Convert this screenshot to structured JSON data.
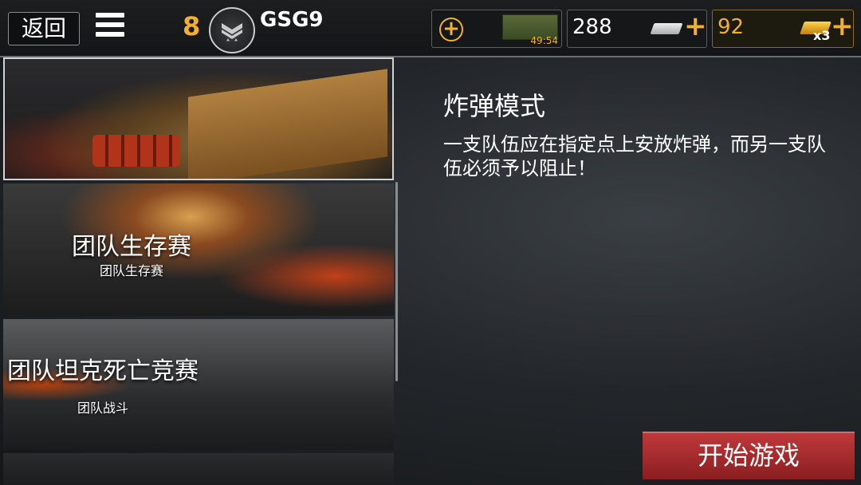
{
  "header": {
    "back_label": "返回",
    "level": "8",
    "player_name": "GSG9",
    "crate_timer": "49:54",
    "silver": "288",
    "gold": "92",
    "gold_multiplier": "x3"
  },
  "modes": [
    {
      "title": "",
      "subtitle": "",
      "selected": true,
      "icon": "dynamite-crate-image"
    },
    {
      "title": "团队生存赛",
      "subtitle": "团队生存赛",
      "selected": false
    },
    {
      "title": "团队坦克死亡竞赛",
      "subtitle": "团队战斗",
      "selected": false
    },
    {
      "title": "",
      "subtitle": "",
      "selected": false
    }
  ],
  "detail": {
    "title": "炸弹模式",
    "description": "一支队伍应在指定点上安放炸弹，而另一支队伍必须予以阻止！"
  },
  "start_label": "开始游戏",
  "colors": {
    "accent": "#f0b030",
    "start": "#a82a2c"
  }
}
